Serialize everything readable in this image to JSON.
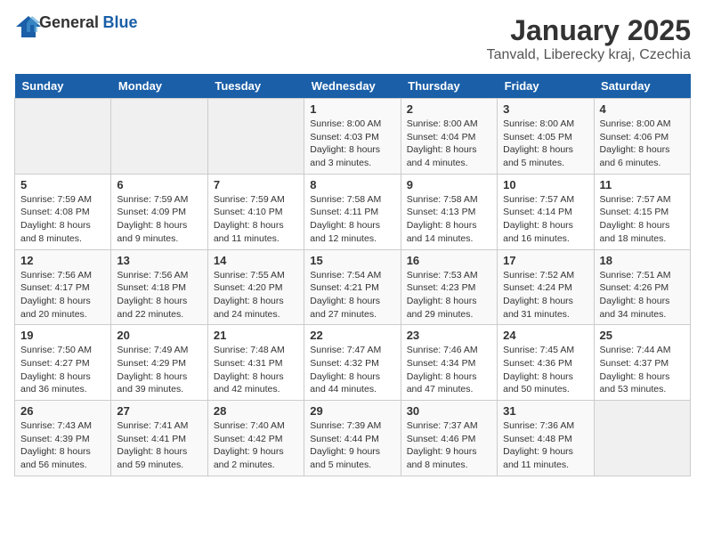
{
  "header": {
    "logo_general": "General",
    "logo_blue": "Blue",
    "title": "January 2025",
    "subtitle": "Tanvald, Liberecky kraj, Czechia"
  },
  "days_of_week": [
    "Sunday",
    "Monday",
    "Tuesday",
    "Wednesday",
    "Thursday",
    "Friday",
    "Saturday"
  ],
  "weeks": [
    [
      {
        "day": "",
        "info": ""
      },
      {
        "day": "",
        "info": ""
      },
      {
        "day": "",
        "info": ""
      },
      {
        "day": "1",
        "info": "Sunrise: 8:00 AM\nSunset: 4:03 PM\nDaylight: 8 hours and 3 minutes."
      },
      {
        "day": "2",
        "info": "Sunrise: 8:00 AM\nSunset: 4:04 PM\nDaylight: 8 hours and 4 minutes."
      },
      {
        "day": "3",
        "info": "Sunrise: 8:00 AM\nSunset: 4:05 PM\nDaylight: 8 hours and 5 minutes."
      },
      {
        "day": "4",
        "info": "Sunrise: 8:00 AM\nSunset: 4:06 PM\nDaylight: 8 hours and 6 minutes."
      }
    ],
    [
      {
        "day": "5",
        "info": "Sunrise: 7:59 AM\nSunset: 4:08 PM\nDaylight: 8 hours and 8 minutes."
      },
      {
        "day": "6",
        "info": "Sunrise: 7:59 AM\nSunset: 4:09 PM\nDaylight: 8 hours and 9 minutes."
      },
      {
        "day": "7",
        "info": "Sunrise: 7:59 AM\nSunset: 4:10 PM\nDaylight: 8 hours and 11 minutes."
      },
      {
        "day": "8",
        "info": "Sunrise: 7:58 AM\nSunset: 4:11 PM\nDaylight: 8 hours and 12 minutes."
      },
      {
        "day": "9",
        "info": "Sunrise: 7:58 AM\nSunset: 4:13 PM\nDaylight: 8 hours and 14 minutes."
      },
      {
        "day": "10",
        "info": "Sunrise: 7:57 AM\nSunset: 4:14 PM\nDaylight: 8 hours and 16 minutes."
      },
      {
        "day": "11",
        "info": "Sunrise: 7:57 AM\nSunset: 4:15 PM\nDaylight: 8 hours and 18 minutes."
      }
    ],
    [
      {
        "day": "12",
        "info": "Sunrise: 7:56 AM\nSunset: 4:17 PM\nDaylight: 8 hours and 20 minutes."
      },
      {
        "day": "13",
        "info": "Sunrise: 7:56 AM\nSunset: 4:18 PM\nDaylight: 8 hours and 22 minutes."
      },
      {
        "day": "14",
        "info": "Sunrise: 7:55 AM\nSunset: 4:20 PM\nDaylight: 8 hours and 24 minutes."
      },
      {
        "day": "15",
        "info": "Sunrise: 7:54 AM\nSunset: 4:21 PM\nDaylight: 8 hours and 27 minutes."
      },
      {
        "day": "16",
        "info": "Sunrise: 7:53 AM\nSunset: 4:23 PM\nDaylight: 8 hours and 29 minutes."
      },
      {
        "day": "17",
        "info": "Sunrise: 7:52 AM\nSunset: 4:24 PM\nDaylight: 8 hours and 31 minutes."
      },
      {
        "day": "18",
        "info": "Sunrise: 7:51 AM\nSunset: 4:26 PM\nDaylight: 8 hours and 34 minutes."
      }
    ],
    [
      {
        "day": "19",
        "info": "Sunrise: 7:50 AM\nSunset: 4:27 PM\nDaylight: 8 hours and 36 minutes."
      },
      {
        "day": "20",
        "info": "Sunrise: 7:49 AM\nSunset: 4:29 PM\nDaylight: 8 hours and 39 minutes."
      },
      {
        "day": "21",
        "info": "Sunrise: 7:48 AM\nSunset: 4:31 PM\nDaylight: 8 hours and 42 minutes."
      },
      {
        "day": "22",
        "info": "Sunrise: 7:47 AM\nSunset: 4:32 PM\nDaylight: 8 hours and 44 minutes."
      },
      {
        "day": "23",
        "info": "Sunrise: 7:46 AM\nSunset: 4:34 PM\nDaylight: 8 hours and 47 minutes."
      },
      {
        "day": "24",
        "info": "Sunrise: 7:45 AM\nSunset: 4:36 PM\nDaylight: 8 hours and 50 minutes."
      },
      {
        "day": "25",
        "info": "Sunrise: 7:44 AM\nSunset: 4:37 PM\nDaylight: 8 hours and 53 minutes."
      }
    ],
    [
      {
        "day": "26",
        "info": "Sunrise: 7:43 AM\nSunset: 4:39 PM\nDaylight: 8 hours and 56 minutes."
      },
      {
        "day": "27",
        "info": "Sunrise: 7:41 AM\nSunset: 4:41 PM\nDaylight: 8 hours and 59 minutes."
      },
      {
        "day": "28",
        "info": "Sunrise: 7:40 AM\nSunset: 4:42 PM\nDaylight: 9 hours and 2 minutes."
      },
      {
        "day": "29",
        "info": "Sunrise: 7:39 AM\nSunset: 4:44 PM\nDaylight: 9 hours and 5 minutes."
      },
      {
        "day": "30",
        "info": "Sunrise: 7:37 AM\nSunset: 4:46 PM\nDaylight: 9 hours and 8 minutes."
      },
      {
        "day": "31",
        "info": "Sunrise: 7:36 AM\nSunset: 4:48 PM\nDaylight: 9 hours and 11 minutes."
      },
      {
        "day": "",
        "info": ""
      }
    ]
  ]
}
